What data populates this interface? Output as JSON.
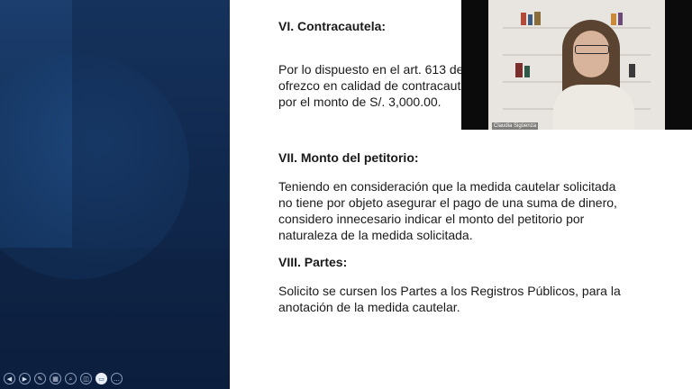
{
  "slide": {
    "heading_vi": "VI. Contracautela:",
    "para_vi_lines": [
      "Por lo dispuesto en el art. 613 de",
      "ofrezco en calidad de contracaut",
      "por el monto de S/. 3,000.00."
    ],
    "heading_vii": "VII. Monto del petitorio:",
    "para_vii_lines": [
      "Teniendo en consideración que la medida cautelar solicitada",
      "no tiene por objeto asegurar el pago de una suma de dinero,",
      "considero innecesario indicar el monto del petitorio por",
      "naturaleza de la medida solicitada."
    ],
    "heading_viii": "VIII. Partes:",
    "para_viii_lines": [
      "Solicito se cursen los Partes a los Registros Públicos, para la",
      "anotación de la medida cautelar."
    ]
  },
  "webcam": {
    "participant_name": "Claudia Sigüenza"
  },
  "presenter_controls": {
    "items": [
      {
        "name": "previous-slide-icon",
        "glyph": "◀"
      },
      {
        "name": "next-slide-icon",
        "glyph": "▶"
      },
      {
        "name": "pen-icon",
        "glyph": "✎"
      },
      {
        "name": "slides-grid-icon",
        "glyph": "▦"
      },
      {
        "name": "zoom-icon",
        "glyph": "⌕"
      },
      {
        "name": "subtitles-icon",
        "glyph": "◫"
      },
      {
        "name": "camera-icon",
        "glyph": "▭"
      },
      {
        "name": "more-options-icon",
        "glyph": "…"
      }
    ],
    "active_index": 6
  },
  "colors": {
    "sidebar_bg": "#1b3e6e",
    "slide_bg": "#ffffff",
    "text": "#1a1a1a"
  }
}
